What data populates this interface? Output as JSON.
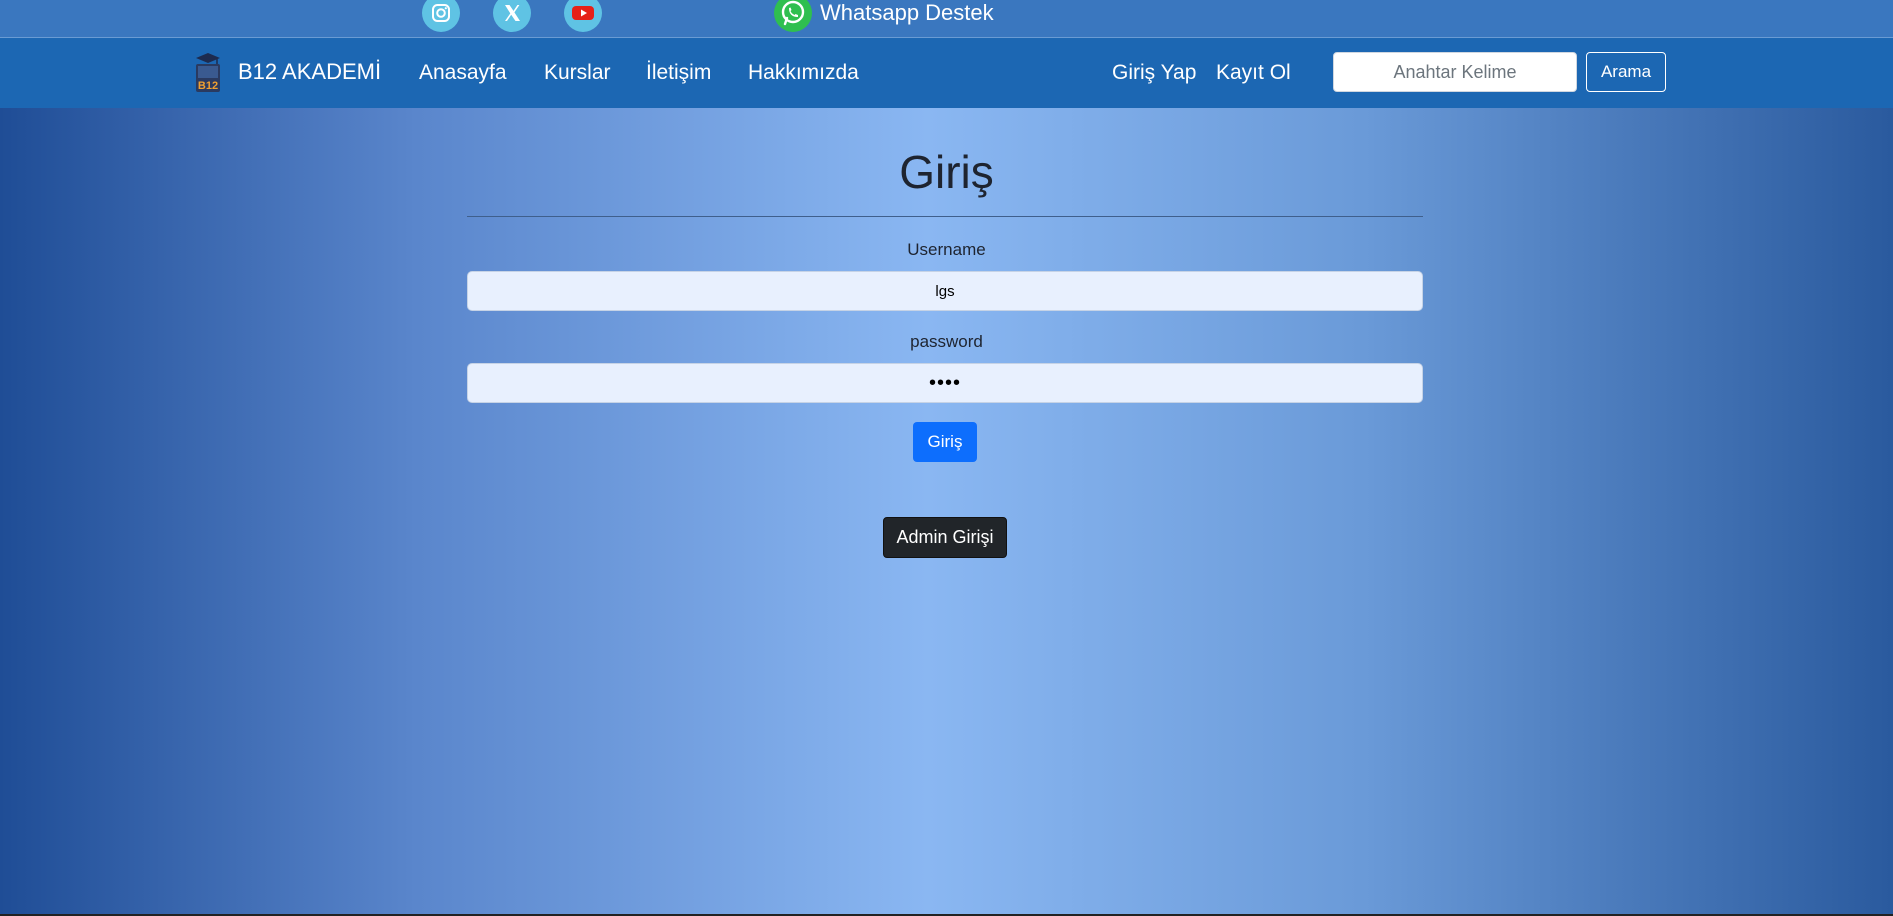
{
  "topbar": {
    "social": [
      {
        "icon": "instagram-icon"
      },
      {
        "icon": "x-twitter-icon"
      },
      {
        "icon": "youtube-icon"
      }
    ],
    "whatsapp_icon": "whatsapp-icon",
    "whatsapp_label": "Whatsapp Destek"
  },
  "navbar": {
    "brand": "B12 AKADEMİ",
    "logo_text": "B12",
    "links": [
      "Anasayfa",
      "Kurslar",
      "İletişim",
      "Hakkımızda"
    ],
    "login": "Giriş Yap",
    "register": "Kayıt Ol",
    "search_placeholder": "Anahtar Kelime",
    "search_button": "Arama"
  },
  "form": {
    "title": "Giriş",
    "username_label": "Username",
    "username_value": "lgs",
    "password_label": "password",
    "password_value": "••••",
    "submit": "Giriş",
    "admin_button": "Admin Girişi"
  },
  "colors": {
    "navbar": "#1c67b3",
    "topbar": "#3a77bf",
    "primary": "#0d6efd",
    "dark": "#212529",
    "social": "#5fc3e4",
    "whatsapp": "#2fbf4f"
  }
}
